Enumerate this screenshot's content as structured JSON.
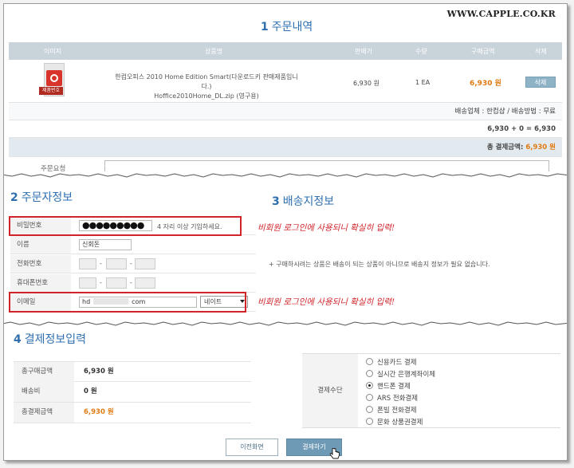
{
  "watermark": "WWW.CAPPLE.CO.KR",
  "order": {
    "section_num": "1",
    "section_title": "주문내역",
    "columns": [
      "이미지",
      "상품명",
      "판매가",
      "수량",
      "구매금액",
      "삭제"
    ],
    "product": {
      "image_badge": "제품번호",
      "name_line1": "한컴오피스 2010 Home Edition Smart(다운로드키 판매제품입니다.)",
      "name_line2": "Hoffice2010Home_DL.zip (영구용)",
      "price": "6,930 원",
      "qty": "1 EA",
      "total": "6,930 원",
      "delete_label": "삭제"
    },
    "shipping_info": "배송업체 : 한컴샵 / 배송방법 : 무료",
    "sum_line": "6,930 + 0 = 6,930",
    "total_label": "총 결제금액:",
    "total_amount": "6,930 원",
    "memo_label": "주문요청"
  },
  "orderer": {
    "section_num": "2",
    "section_title": "주문자정보",
    "password_label": "비밀번호",
    "password_value": "●●●●●●●●●",
    "password_hint": "4 자리 이상 기입하세요.",
    "name_label": "이름",
    "name_value": "신회돈",
    "phone_label": "전화번호",
    "mobile_label": "휴대폰번호",
    "email_label": "이메일",
    "email_local": "hd",
    "email_domain_tail": "com",
    "email_select": "네이트"
  },
  "annotations": {
    "password_note": "비회원 로그인에 사용되니 확실히 입력!",
    "email_note": "비회원 로그인에 사용되니 확실히 입력!"
  },
  "shipping": {
    "section_num": "3",
    "section_title": "배송지정보",
    "note": "+ 구매하시려는 상품은 배송이 되는 상품이 아니므로 배송지 정보가 필요 없습니다."
  },
  "payment": {
    "section_num": "4",
    "section_title": "결제정보입력",
    "rows": [
      {
        "label": "총구매금액",
        "value": "6,930 원"
      },
      {
        "label": "배송비",
        "value": "0 원"
      },
      {
        "label": "총결제금액",
        "value": "6,930 원"
      }
    ],
    "method_label": "결제수단",
    "methods": [
      "신용카드 결제",
      "실시간 은행계좌이체",
      "핸드폰 결제",
      "ARS 전화결제",
      "폰빌 전화결제",
      "문화 상품권결제"
    ],
    "selected_method": "핸드폰 결제"
  },
  "buttons": {
    "prev": "이전화면",
    "pay": "결제하기"
  },
  "colors": {
    "accent_blue": "#2f6fb0",
    "price_orange": "#e07b13",
    "annotation_red": "#d2232a",
    "header_gray": "#c9d3da"
  }
}
